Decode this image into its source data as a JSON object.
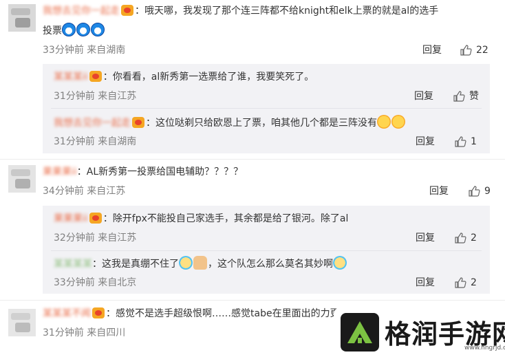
{
  "comments": [
    {
      "username": "我想去见你一起走",
      "text": "哦天哪，我发现了那个连三阵都不给knight和elk上票的就是al的选手",
      "text2": "投票",
      "meta": "33分钟前 来自湖南",
      "reply": "回复",
      "likes": "22",
      "replies": [
        {
          "username": "某某某ii",
          "text": "你看看，al新秀第一选票给了谁，我要笑死了。",
          "meta": "31分钟前 来自江苏",
          "reply": "回复",
          "likes": "赞"
        },
        {
          "username": "我想去见你一起走",
          "text": "这位哒剃只给欧恩上了票，咱其他几个都是三阵没有",
          "meta": "31分钟前 来自湖南",
          "reply": "回复",
          "likes": "1"
        }
      ]
    },
    {
      "username": "果果果ii",
      "text": "AL新秀第一投票给国电辅助？？？？",
      "meta": "34分钟前 来自江苏",
      "reply": "回复",
      "likes": "9",
      "replies": [
        {
          "username": "果果果ii",
          "text": "除开fpx不能投自己家选手，其余都是给了银河。除了al",
          "meta": "32分钟前 来自江苏",
          "reply": "回复",
          "likes": "2"
        },
        {
          "username": "某某某某",
          "text": "这我是真绷不住了",
          "text_b": "，这个队怎么那么莫名其妙啊",
          "meta": "33分钟前 来自北京",
          "reply": "回复",
          "likes": "2"
        }
      ]
    },
    {
      "username": "某某某不闻",
      "text": "感觉不是选手超级恨啊……感觉tabe在里面出的力更大",
      "meta": "31分钟前 来自四川"
    }
  ],
  "watermark": {
    "text": "格润手游网",
    "url": "www.hngrjd.com"
  }
}
